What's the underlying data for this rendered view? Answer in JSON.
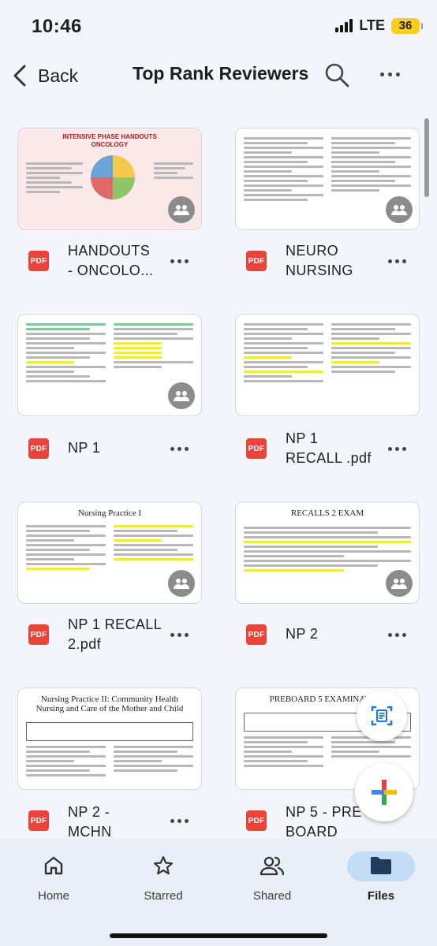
{
  "status": {
    "time": "10:46",
    "network": "LTE",
    "battery": "36"
  },
  "appbar": {
    "back_label": "Back",
    "title": "Top Rank Reviewers"
  },
  "files": [
    {
      "name_line1": "HANDOUTS",
      "name_line2": "- ONCOLO...",
      "type": "PDF"
    },
    {
      "name_line1": "NEURO",
      "name_line2": "NURSING",
      "type": "PDF"
    },
    {
      "name_line1": "NP 1",
      "name_line2": "",
      "type": "PDF"
    },
    {
      "name_line1": "NP 1",
      "name_line2": "RECALL .pdf",
      "type": "PDF"
    },
    {
      "name_line1": "NP 1 RECALL",
      "name_line2": "2.pdf",
      "type": "PDF"
    },
    {
      "name_line1": "NP 2",
      "name_line2": "",
      "type": "PDF"
    },
    {
      "name_line1": "NP 2 -",
      "name_line2": "MCHN",
      "type": "PDF"
    },
    {
      "name_line1": "NP 5 - PRE",
      "name_line2": "BOARD",
      "type": "PDF"
    }
  ],
  "thumb_titles": {
    "onco": "INTENSIVE PHASE HANDOUTS ONCOLOGY",
    "np1recall2": "Nursing Practice I",
    "np2": "RECALLS 2 EXAM",
    "mchn": "Nursing Practice II: Community Health Nursing and Care of the Mother and Child",
    "preboard": "PREBOARD 5 EXAMINATION"
  },
  "nav": [
    {
      "label": "Home",
      "icon": "home-icon"
    },
    {
      "label": "Starred",
      "icon": "star-icon"
    },
    {
      "label": "Shared",
      "icon": "shared-icon"
    },
    {
      "label": "Files",
      "icon": "folder-icon",
      "active": true
    }
  ],
  "colors": {
    "pdf": "#e8443a",
    "active_pill": "#c2dcf5",
    "battery": "#f7cf1a"
  }
}
